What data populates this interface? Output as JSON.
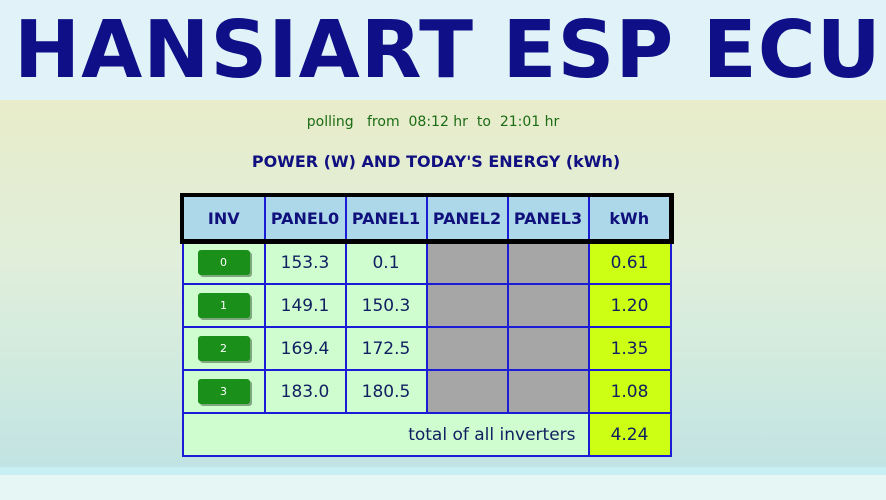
{
  "header": {
    "title": "HANSIART ESP ECU"
  },
  "polling": {
    "label": "polling",
    "from_label": "from",
    "from_time": "08:12 hr",
    "to_label": "to",
    "to_time": "21:01 hr"
  },
  "section": {
    "title": "POWER (W) AND TODAY'S ENERGY (kWh)"
  },
  "table": {
    "columns": [
      "INV",
      "PANEL0",
      "PANEL1",
      "PANEL2",
      "PANEL3",
      "kWh"
    ],
    "rows": [
      {
        "inv": "0",
        "panel0": "153.3",
        "panel1": "0.1",
        "panel2": "",
        "panel3": "",
        "kwh": "0.61"
      },
      {
        "inv": "1",
        "panel0": "149.1",
        "panel1": "150.3",
        "panel2": "",
        "panel3": "",
        "kwh": "1.20"
      },
      {
        "inv": "2",
        "panel0": "169.4",
        "panel1": "172.5",
        "panel2": "",
        "panel3": "",
        "kwh": "1.35"
      },
      {
        "inv": "3",
        "panel0": "183.0",
        "panel1": "180.5",
        "panel2": "",
        "panel3": "",
        "kwh": "1.08"
      }
    ],
    "total_label": "total of all inverters",
    "total_kwh": "4.24"
  },
  "colors": {
    "title": "#0f0f87",
    "header_bg": "#e1f3f8",
    "table_header_bg": "#acd8ea",
    "cell_bg": "#d0fdd0",
    "empty_cell_bg": "#a6a6a6",
    "kwh_cell_bg": "#ccff14",
    "button_bg": "#1a8f1a",
    "border": "#1c1cd6",
    "polling_text": "#1b6b14"
  }
}
